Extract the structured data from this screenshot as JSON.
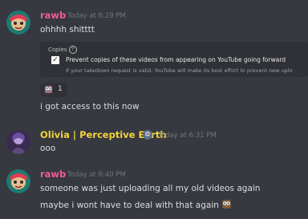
{
  "messages": [
    {
      "author": "rawb",
      "author_color": "#f25c9b",
      "timestamp": "Today at 6:29 PM",
      "lines": [
        "ohhhh shitttt",
        "i got access to this now"
      ],
      "embed": {
        "section_label": "Copies",
        "checkbox_label": "Prevent copies of these videos from appearing on YouTube going forward",
        "checkbox_checked": true,
        "subtext": "If your takedown request is valid, YouTube will make its best effort to prevent new uplo"
      },
      "reaction": {
        "emoji": "owl-emoji",
        "count": "1"
      }
    },
    {
      "author": "Olivia | Perceptive Earth",
      "author_color": "#f5d33d",
      "timestamp": "Today at 6:31 PM",
      "lines": [
        "ooo"
      ]
    },
    {
      "author": "rawb",
      "author_color": "#f25c9b",
      "timestamp": "Today at 6:40 PM",
      "lines": [
        "someone was just uploading all my old videos again",
        "maybe i wont have to deal with that again"
      ]
    }
  ]
}
